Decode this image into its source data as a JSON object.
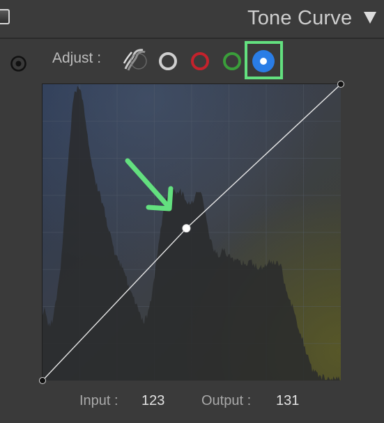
{
  "header": {
    "title": "Tone Curve"
  },
  "adjust": {
    "label": "Adjust :",
    "channels": [
      {
        "name": "parametric",
        "icon": "parametric-curve-icon"
      },
      {
        "name": "rgb",
        "icon": "white-circle-icon",
        "color": "#cfcfcf"
      },
      {
        "name": "red",
        "icon": "red-circle-icon",
        "color": "#c4222c"
      },
      {
        "name": "green",
        "icon": "green-circle-icon",
        "color": "#3a9e3a"
      },
      {
        "name": "blue",
        "icon": "blue-dot-icon",
        "color": "#2a7de6",
        "selected": true
      }
    ],
    "highlight_color": "#63e07f"
  },
  "curve": {
    "points": [
      {
        "input": 0,
        "output": 0
      },
      {
        "input": 123,
        "output": 131
      },
      {
        "input": 255,
        "output": 255
      }
    ],
    "range": [
      0,
      255
    ]
  },
  "annotation": {
    "arrow_color": "#63e07f"
  },
  "readout": {
    "input_label": "Input :",
    "input_value": "123",
    "output_label": "Output :",
    "output_value": "131"
  }
}
